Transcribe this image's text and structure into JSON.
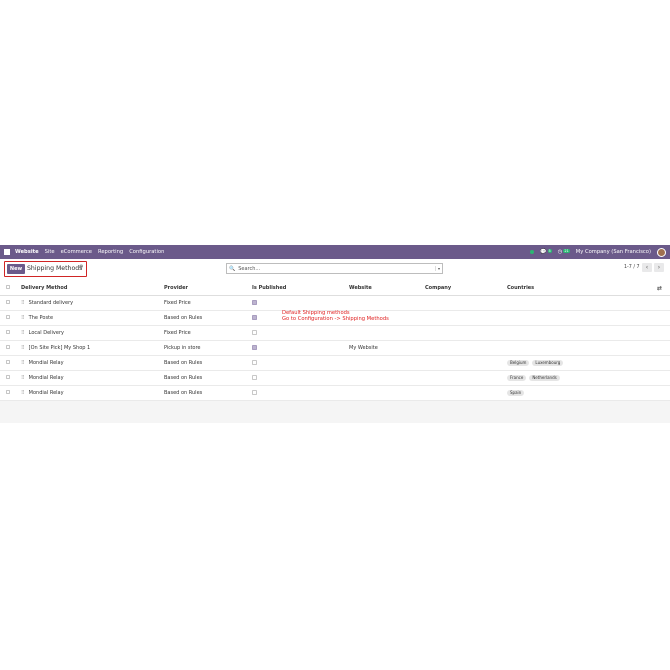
{
  "navbar": {
    "brand": "Website",
    "menu": [
      "Site",
      "eCommerce",
      "Reporting",
      "Configuration"
    ],
    "company": "My Company (San Francisco)",
    "messages_count": "5",
    "activity_count": "21"
  },
  "control": {
    "new_label": "New",
    "title": "Shipping Methods",
    "search_placeholder": "Search...",
    "pager": "1-7 / 7"
  },
  "table": {
    "columns": [
      "Delivery Method",
      "Provider",
      "Is Published",
      "Website",
      "Company",
      "Countries"
    ],
    "rows": [
      {
        "name": "Standard delivery",
        "provider": "Fixed Price",
        "published": true,
        "website": "",
        "company": "",
        "countries": []
      },
      {
        "name": "The Poste",
        "provider": "Based on Rules",
        "published": true,
        "website": "",
        "company": "",
        "countries": []
      },
      {
        "name": "Local Delivery",
        "provider": "Fixed Price",
        "published": false,
        "website": "",
        "company": "",
        "countries": []
      },
      {
        "name": "[On Site Pick] My Shop 1",
        "provider": "Pickup in store",
        "published": true,
        "website": "My Website",
        "company": "",
        "countries": []
      },
      {
        "name": "Mondial Relay",
        "provider": "Based on Rules",
        "published": false,
        "website": "",
        "company": "",
        "countries": [
          "Belgium",
          "Luxembourg"
        ]
      },
      {
        "name": "Mondial Relay",
        "provider": "Based on Rules",
        "published": false,
        "website": "",
        "company": "",
        "countries": [
          "France",
          "Netherlands"
        ]
      },
      {
        "name": "Mondial Relay",
        "provider": "Based on Rules",
        "published": false,
        "website": "",
        "company": "",
        "countries": [
          "Spain"
        ]
      }
    ]
  },
  "annotation": {
    "line1": "Default Shipping methods",
    "line2": "Go to Configuration -> Shipping Methods"
  },
  "colors": {
    "brand": "#6b5a8a",
    "highlight": "#d02525",
    "annotation": "#e02020"
  }
}
